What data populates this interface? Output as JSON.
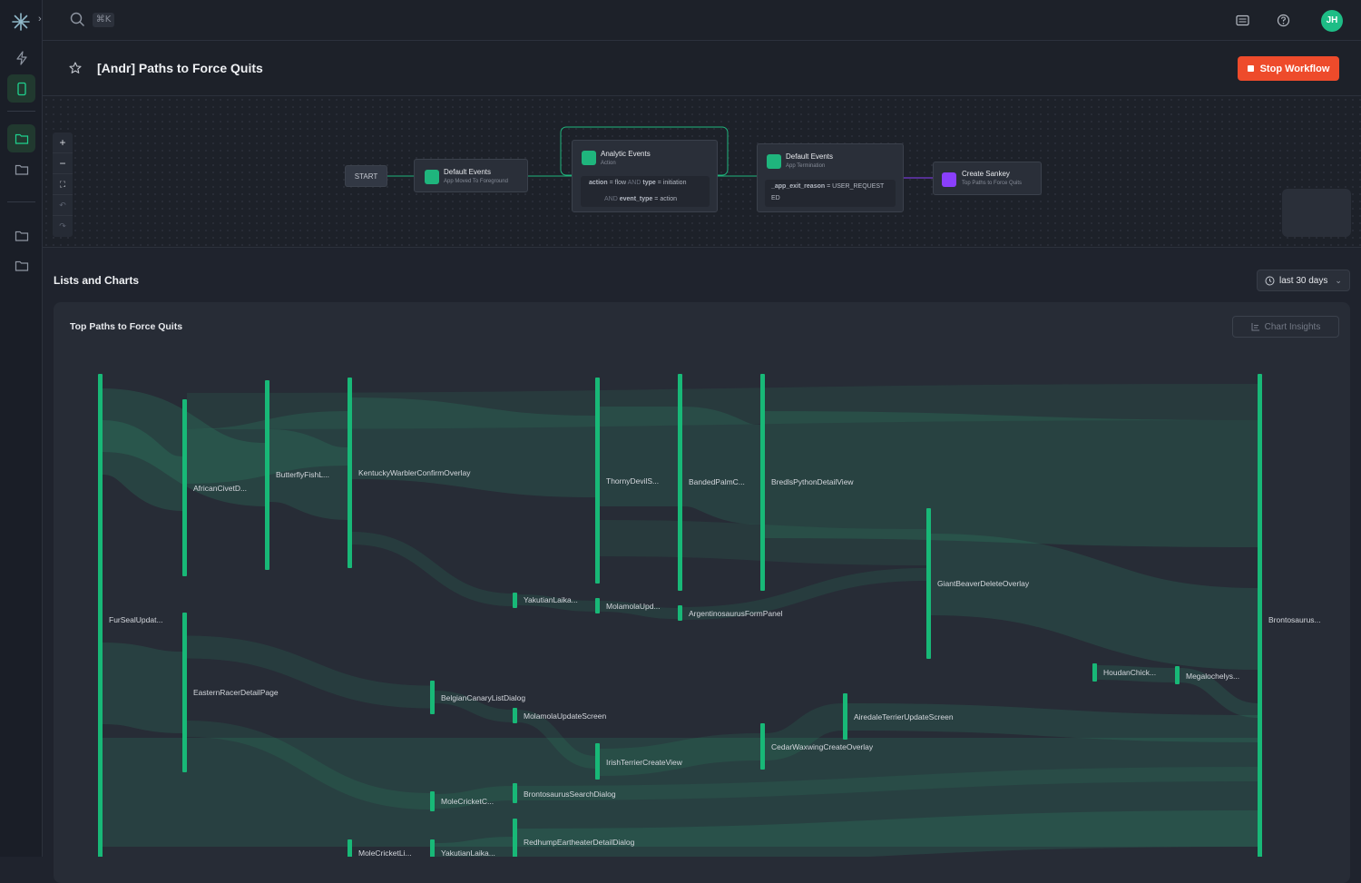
{
  "topbar": {
    "shortcut": "⌘K",
    "avatar_initials": "JH"
  },
  "header": {
    "title": "[Andr] Paths to Force Quits",
    "stop_button": "Stop Workflow"
  },
  "workflow": {
    "start": "START",
    "node1": {
      "title": "Default Events",
      "subtitle": "App Moved To Foreground"
    },
    "node2": {
      "title": "Analytic Events",
      "subtitle": "Action",
      "cond1": {
        "k1": "action",
        "op1": "=",
        "v1": "flow",
        "and": "AND",
        "k2": "type",
        "op2": "=",
        "v2": "initiation"
      },
      "cond2": {
        "and": "AND",
        "k": "event_type",
        "op": "=",
        "v": "action"
      }
    },
    "node3": {
      "title": "Default Events",
      "subtitle": "App Termination",
      "cond": {
        "k": "_app_exit_reason",
        "op": "=",
        "v": "USER_REQUEST",
        "wrap": "ED"
      }
    },
    "node4": {
      "title": "Create Sankey",
      "subtitle": "Top Paths to Force Quits"
    }
  },
  "section": {
    "title": "Lists and Charts",
    "range": "last 30 days"
  },
  "card": {
    "title": "Top Paths to Force Quits",
    "insights_button": "Chart Insights"
  },
  "colors": {
    "accent": "#1fb57d",
    "danger": "#ee4b2b",
    "purple": "#8a3ffc"
  },
  "chart_data": {
    "type": "sankey",
    "nodes": [
      {
        "label": "FurSealUpdat..."
      },
      {
        "label": "AfricanCivetD..."
      },
      {
        "label": "EasternRacerDetailPage"
      },
      {
        "label": "ButterflyFishL..."
      },
      {
        "label": "KentuckyWarblerConfirmOverlay"
      },
      {
        "label": "MoleCricketLi..."
      },
      {
        "label": "BelgianCanaryListDialog"
      },
      {
        "label": "MoleCricketC..."
      },
      {
        "label": "YakutianLaika..."
      },
      {
        "label": "YakutianLaika..."
      },
      {
        "label": "MolamolaUpdateScreen"
      },
      {
        "label": "BrontosaurusSearchDialog"
      },
      {
        "label": "RedhumpEartheaterDetailDialog"
      },
      {
        "label": "ThornyDevilS..."
      },
      {
        "label": "MolamolaUpd..."
      },
      {
        "label": "IrishTerrierCreateView"
      },
      {
        "label": "BandedPalmC..."
      },
      {
        "label": "ArgentinosaurusFormPanel"
      },
      {
        "label": "BredlsPythonDetailView"
      },
      {
        "label": "CedarWaxwingCreateOverlay"
      },
      {
        "label": "AiredaleTerrierUpdateScreen"
      },
      {
        "label": "GiantBeaverDeleteOverlay"
      },
      {
        "label": "HoudanChick..."
      },
      {
        "label": "Megalochelys..."
      },
      {
        "label": "Brontosaurus..."
      }
    ]
  }
}
